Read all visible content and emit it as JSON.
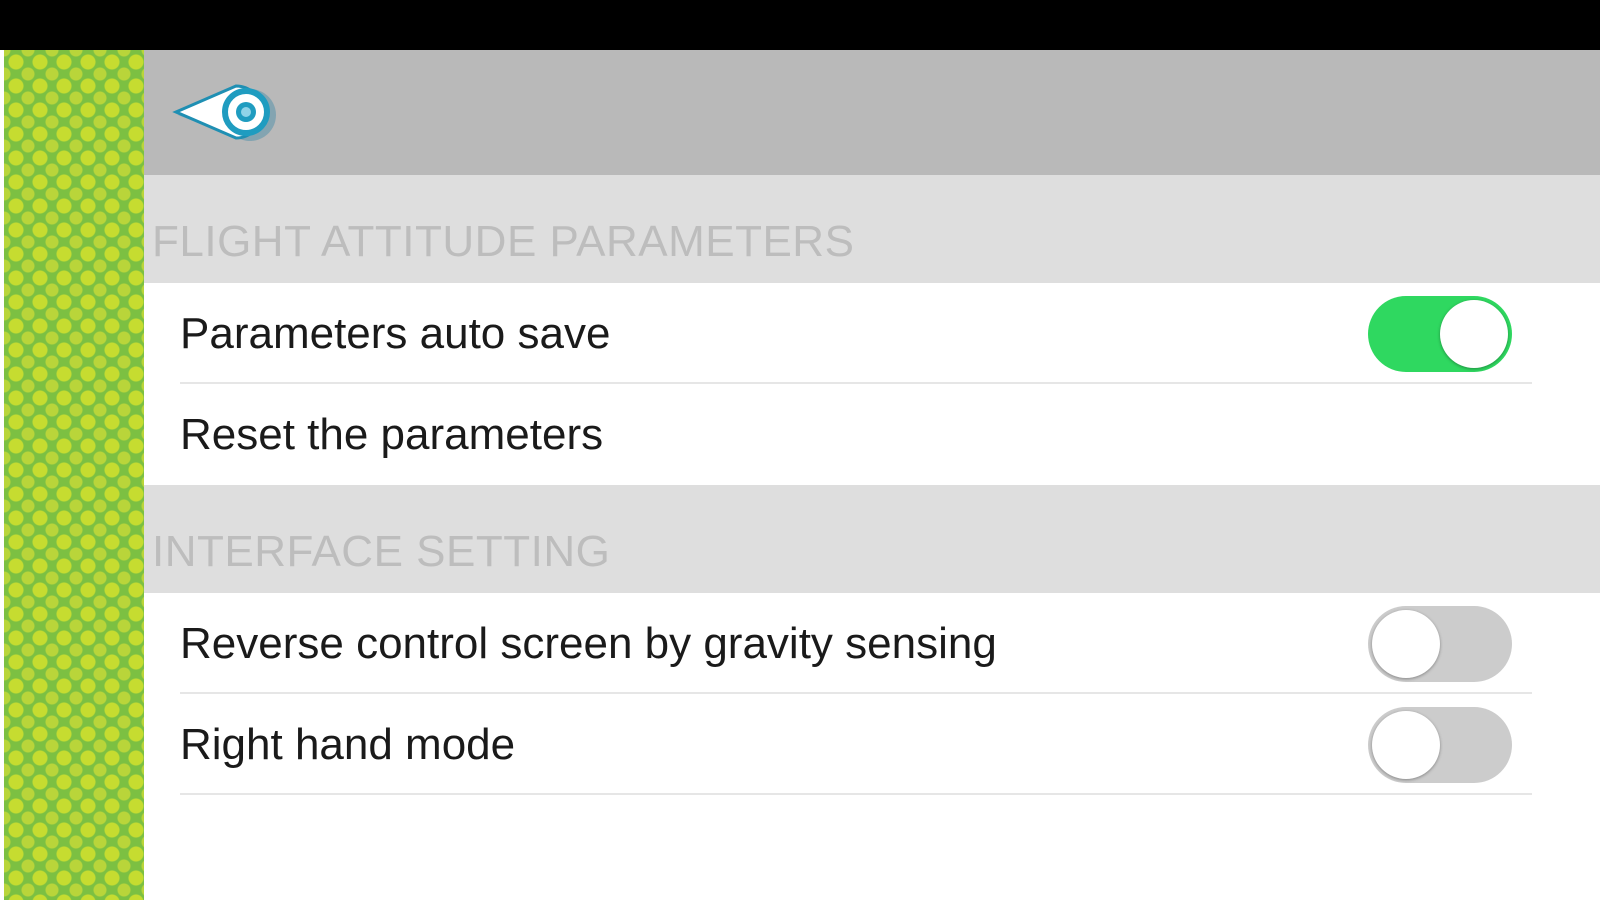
{
  "header": {
    "back_icon": "back-arrow-icon"
  },
  "sections": [
    {
      "title": "FLIGHT ATTITUDE PARAMETERS",
      "items": [
        {
          "label": "Parameters auto save",
          "toggle": true,
          "on": true
        },
        {
          "label": "Reset the parameters",
          "toggle": false
        }
      ]
    },
    {
      "title": "INTERFACE SETTING",
      "items": [
        {
          "label": "Reverse control screen by gravity sensing",
          "toggle": true,
          "on": false
        },
        {
          "label": "Right hand mode",
          "toggle": true,
          "on": false
        }
      ]
    }
  ],
  "colors": {
    "toggle_on": "#2fd860",
    "toggle_off": "#cccccc",
    "header_bg": "#b9b9b9",
    "section_bg": "#dedede",
    "side_panel": "#7cc042"
  }
}
